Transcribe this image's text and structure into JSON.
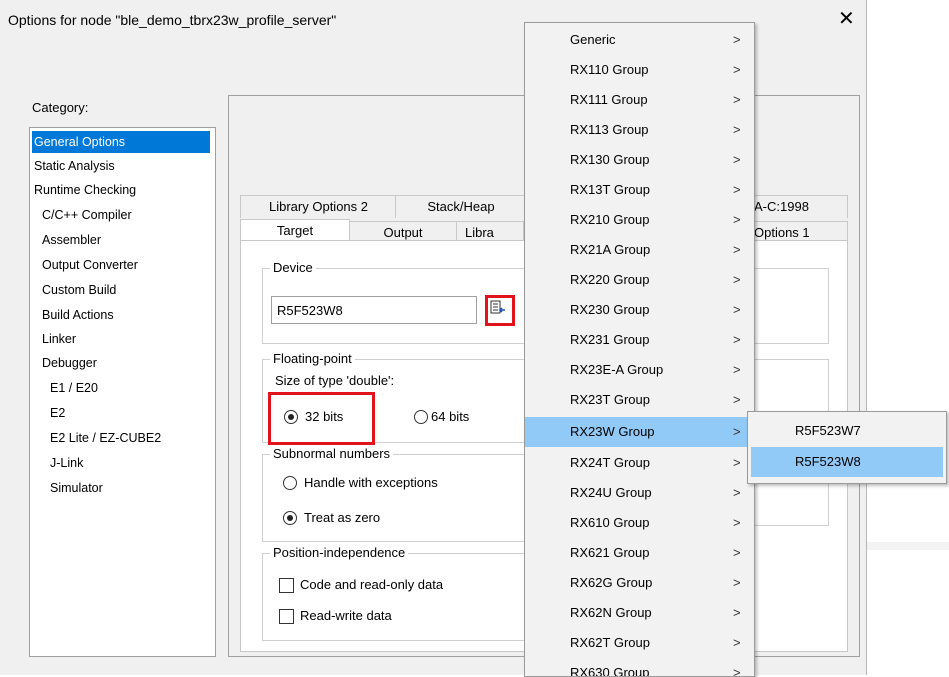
{
  "dialog": {
    "title": "Options for node \"ble_demo_tbrx23w_profile_server\"",
    "close_glyph": "✕",
    "category_label": "Category:",
    "categories": [
      {
        "label": "General Options",
        "selected": true
      },
      {
        "label": "Static Analysis"
      },
      {
        "label": "Runtime Checking"
      },
      {
        "label": "C/C++ Compiler"
      },
      {
        "label": "Assembler"
      },
      {
        "label": "Output Converter"
      },
      {
        "label": "Custom Build"
      },
      {
        "label": "Build Actions"
      },
      {
        "label": "Linker"
      },
      {
        "label": "Debugger"
      },
      {
        "label": "E1 / E20"
      },
      {
        "label": "E2"
      },
      {
        "label": "E2 Lite / EZ-CUBE2"
      },
      {
        "label": "J-Link"
      },
      {
        "label": "Simulator"
      }
    ]
  },
  "tabs": {
    "row_back": [
      "Library Options 2",
      "Stack/Heap",
      "A-C:1998"
    ],
    "row_front": [
      "Target",
      "Output",
      "Libra",
      "Options 1"
    ]
  },
  "target": {
    "device_label": "Device",
    "device_value": "R5F523W8",
    "device_picker_icon": "device-select-icon",
    "floating_point_label": "Floating-point",
    "double_size_label": "Size of type 'double':",
    "opt_32": "32 bits",
    "opt_64": "64 bits",
    "subnormal_label": "Subnormal numbers",
    "handle_exceptions": "Handle with exceptions",
    "treat_zero": "Treat as zero",
    "position_label": "Position-independence",
    "code_readonly": "Code and read-only data",
    "read_write": "Read-write data"
  },
  "menu": {
    "items": [
      "Generic",
      "RX110 Group",
      "RX111 Group",
      "RX113 Group",
      "RX130 Group",
      "RX13T Group",
      "RX210 Group",
      "RX21A Group",
      "RX220 Group",
      "RX230 Group",
      "RX231 Group",
      "RX23E-A Group",
      "RX23T Group",
      "RX23W Group",
      "RX24T Group",
      "RX24U Group",
      "RX610 Group",
      "RX621 Group",
      "RX62G Group",
      "RX62N Group",
      "RX62T Group",
      "RX630 Group"
    ],
    "highlighted": "RX23W Group",
    "arrow": ">"
  },
  "submenu": {
    "items": [
      "R5F523W7",
      "R5F523W8"
    ],
    "highlighted": "R5F523W8"
  }
}
